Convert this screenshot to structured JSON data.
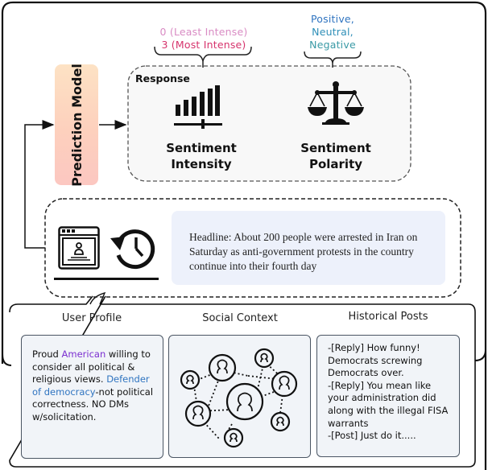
{
  "scales": {
    "intensity": {
      "least": "0 (Least Intense)",
      "most": "3 (Most Intense)"
    },
    "polarity": {
      "positive": "Positive,",
      "neutral": "Neutral,",
      "negative": "Negative"
    }
  },
  "prediction_model": {
    "label": "Prediction Model"
  },
  "response": {
    "label": "Response",
    "outputs": [
      {
        "title_line1": "Sentiment",
        "title_line2": "Intensity",
        "icon": "signal-bars-icon"
      },
      {
        "title_line1": "Sentiment",
        "title_line2": "Polarity",
        "icon": "scales-of-justice-icon"
      }
    ]
  },
  "input": {
    "icons": [
      "user-profile-window-icon",
      "history-icon"
    ],
    "headline": "Headline: About 200 people were arrested in Iran on Saturday as anti-government protests in the country continue into their fourth day"
  },
  "context": {
    "user_profile": {
      "title": "User Profile",
      "text_parts": [
        {
          "text": "Proud ",
          "style": "plain"
        },
        {
          "text": "American",
          "style": "purple"
        },
        {
          "text": " willing to consider all political & religious views. ",
          "style": "plain"
        },
        {
          "text": "Defender of democracy",
          "style": "blue"
        },
        {
          "text": "-not political correctness. NO DMs w/solicitation.",
          "style": "plain"
        }
      ]
    },
    "social_context": {
      "title": "Social Context",
      "icon": "social-network-icon"
    },
    "historical_posts": {
      "title": "Historical Posts",
      "posts": [
        "-[Reply] How funny! Democrats screwing Democrats over.",
        "-[Reply] You mean like your administration did along with the illegal FISA warrants",
        "-[Post] Just do it....."
      ]
    }
  },
  "colors": {
    "least_intense": "#d98cc4",
    "most_intense": "#d6336c",
    "positive": "#2f74c0",
    "neutral": "#2f8fb8",
    "negative": "#3a9aa6",
    "highlight_purple": "#7b2fd0",
    "highlight_blue": "#2f74c0",
    "headline_bg": "#edf1fb",
    "card_bg": "#f1f4f8"
  }
}
